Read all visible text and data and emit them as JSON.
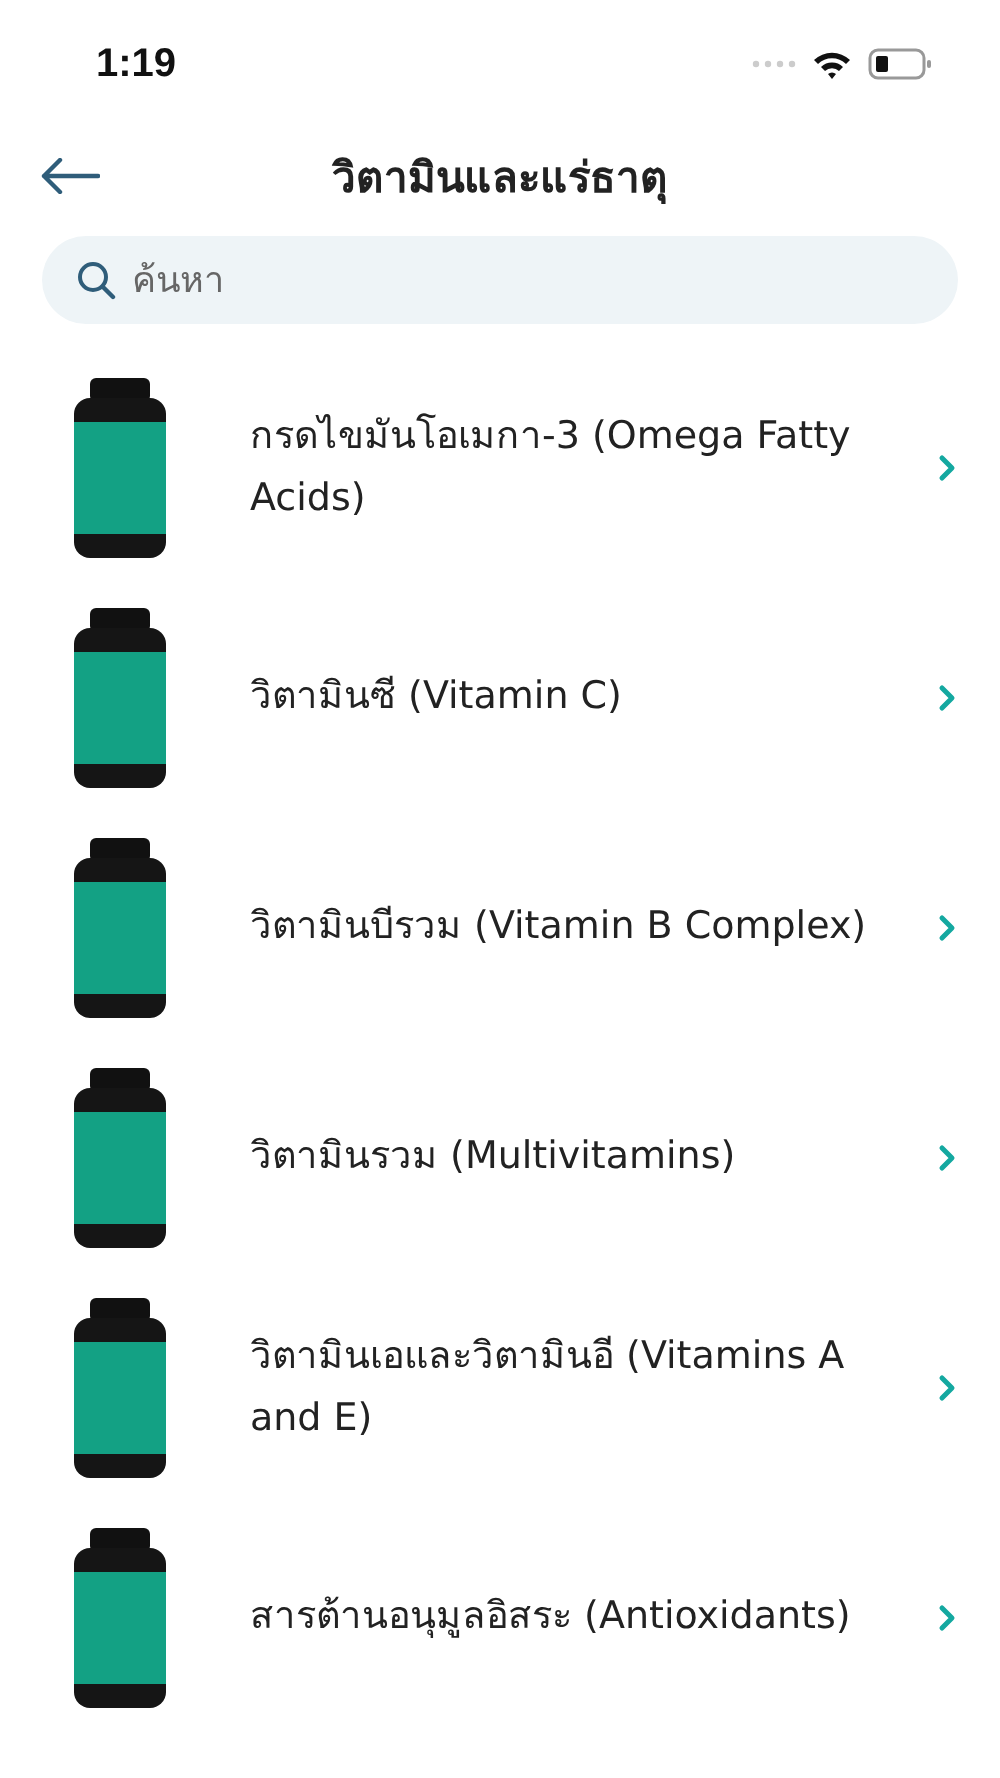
{
  "status_bar": {
    "time": "1:19"
  },
  "header": {
    "title": "วิตามินและแร่ธาตุ"
  },
  "search": {
    "placeholder": "ค้นหา"
  },
  "items": [
    {
      "name": "กรดไขมันโอเมกา-3 (Omega Fatty Acids)"
    },
    {
      "name": "วิตามินซี (Vitamin C)"
    },
    {
      "name": "วิตามินบีรวม (Vitamin B Complex)"
    },
    {
      "name": "วิตามินรวม (Multivitamins)"
    },
    {
      "name": "วิตามินเอและวิตามินอี (Vitamins A and E)"
    },
    {
      "name": "สารต้านอนุมูลอิสระ (Antioxidants)"
    }
  ]
}
